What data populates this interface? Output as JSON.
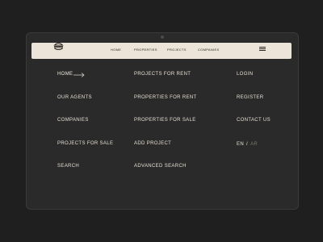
{
  "navbar": {
    "links": [
      "HOME",
      "PROPERTIES",
      "PROJECTS",
      "COMPANIES"
    ],
    "logo_icon": "burger-logo-icon",
    "menu_icon": "hamburger-menu-icon"
  },
  "menu": {
    "col1": [
      "HOME",
      "OUR AGENTS",
      "COMPANIES",
      "PROJECTS FOR SALE",
      "SEARCH"
    ],
    "col2": [
      "PROJECTS FOR RENT",
      "PROPERTIES FOR RENT",
      "PROPERTIES FOR SALE",
      "ADD PROJECT",
      "ADVANCED SEARCH"
    ],
    "col3": [
      "LOGIN",
      "REGISTER",
      "CONTACT US"
    ],
    "active_icon": "arrow-right-icon"
  },
  "language": {
    "current": "EN",
    "separator": "/",
    "other": "AR"
  },
  "colors": {
    "background": "#1f1f1f",
    "panel": "#2a2a2a",
    "navbar": "#ece4d9",
    "text": "#e6dfd4",
    "muted": "#7c776f"
  }
}
